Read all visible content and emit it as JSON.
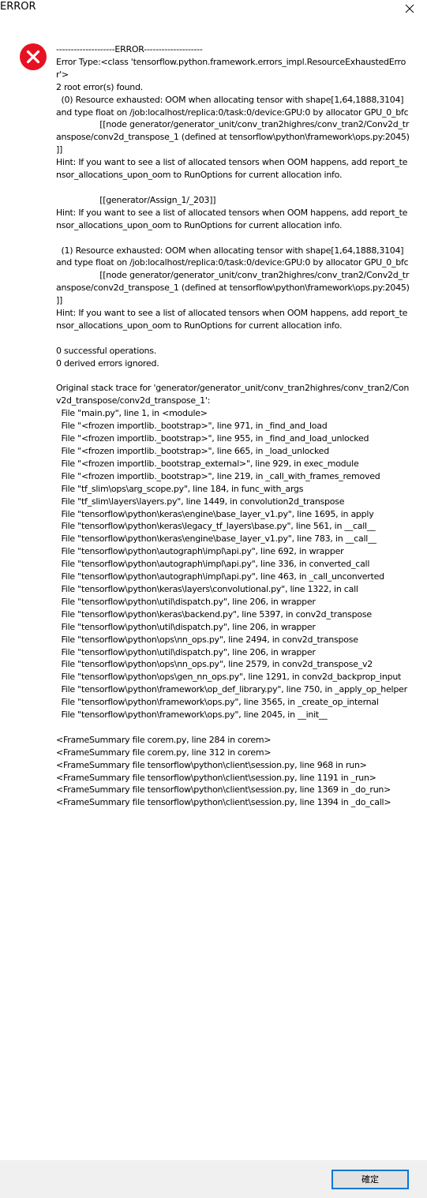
{
  "window": {
    "title": "ERROR",
    "close_icon": "close-icon"
  },
  "dialog": {
    "icon": "error-icon",
    "icon_color": "#e81123",
    "message": "--------------------ERROR--------------------\nError Type:<class 'tensorflow.python.framework.errors_impl.ResourceExhaustedError'>\n2 root error(s) found.\n  (0) Resource exhausted: OOM when allocating tensor with shape[1,64,1888,3104] and type float on /job:localhost/replica:0/task:0/device:GPU:0 by allocator GPU_0_bfc\n                 [[node generator/generator_unit/conv_tran2highres/conv_tran2/Conv2d_transpose/conv2d_transpose_1 (defined at tensorflow\\python\\framework\\ops.py:2045) ]]\nHint: If you want to see a list of allocated tensors when OOM happens, add report_tensor_allocations_upon_oom to RunOptions for current allocation info.\n\n                 [[generator/Assign_1/_203]]\nHint: If you want to see a list of allocated tensors when OOM happens, add report_tensor_allocations_upon_oom to RunOptions for current allocation info.\n\n  (1) Resource exhausted: OOM when allocating tensor with shape[1,64,1888,3104] and type float on /job:localhost/replica:0/task:0/device:GPU:0 by allocator GPU_0_bfc\n                 [[node generator/generator_unit/conv_tran2highres/conv_tran2/Conv2d_transpose/conv2d_transpose_1 (defined at tensorflow\\python\\framework\\ops.py:2045) ]]\nHint: If you want to see a list of allocated tensors when OOM happens, add report_tensor_allocations_upon_oom to RunOptions for current allocation info.\n\n0 successful operations.\n0 derived errors ignored.\n\nOriginal stack trace for 'generator/generator_unit/conv_tran2highres/conv_tran2/Conv2d_transpose/conv2d_transpose_1':\n  File \"main.py\", line 1, in <module>\n  File \"<frozen importlib._bootstrap>\", line 971, in _find_and_load\n  File \"<frozen importlib._bootstrap>\", line 955, in _find_and_load_unlocked\n  File \"<frozen importlib._bootstrap>\", line 665, in _load_unlocked\n  File \"<frozen importlib._bootstrap_external>\", line 929, in exec_module\n  File \"<frozen importlib._bootstrap>\", line 219, in _call_with_frames_removed\n  File \"tf_slim\\ops\\arg_scope.py\", line 184, in func_with_args\n  File \"tf_slim\\layers\\layers.py\", line 1449, in convolution2d_transpose\n  File \"tensorflow\\python\\keras\\engine\\base_layer_v1.py\", line 1695, in apply\n  File \"tensorflow\\python\\keras\\legacy_tf_layers\\base.py\", line 561, in __call__\n  File \"tensorflow\\python\\keras\\engine\\base_layer_v1.py\", line 783, in __call__\n  File \"tensorflow\\python\\autograph\\impl\\api.py\", line 692, in wrapper\n  File \"tensorflow\\python\\autograph\\impl\\api.py\", line 336, in converted_call\n  File \"tensorflow\\python\\autograph\\impl\\api.py\", line 463, in _call_unconverted\n  File \"tensorflow\\python\\keras\\layers\\convolutional.py\", line 1322, in call\n  File \"tensorflow\\python\\util\\dispatch.py\", line 206, in wrapper\n  File \"tensorflow\\python\\keras\\backend.py\", line 5397, in conv2d_transpose\n  File \"tensorflow\\python\\util\\dispatch.py\", line 206, in wrapper\n  File \"tensorflow\\python\\ops\\nn_ops.py\", line 2494, in conv2d_transpose\n  File \"tensorflow\\python\\util\\dispatch.py\", line 206, in wrapper\n  File \"tensorflow\\python\\ops\\nn_ops.py\", line 2579, in conv2d_transpose_v2\n  File \"tensorflow\\python\\ops\\gen_nn_ops.py\", line 1291, in conv2d_backprop_input\n  File \"tensorflow\\python\\framework\\op_def_library.py\", line 750, in _apply_op_helper\n  File \"tensorflow\\python\\framework\\ops.py\", line 3565, in _create_op_internal\n  File \"tensorflow\\python\\framework\\ops.py\", line 2045, in __init__\n\n<FrameSummary file corem.py, line 284 in corem>\n<FrameSummary file corem.py, line 312 in corem>\n<FrameSummary file tensorflow\\python\\client\\session.py, line 968 in run>\n<FrameSummary file tensorflow\\python\\client\\session.py, line 1191 in _run>\n<FrameSummary file tensorflow\\python\\client\\session.py, line 1369 in _do_run>\n<FrameSummary file tensorflow\\python\\client\\session.py, line 1394 in _do_call>"
  },
  "footer": {
    "ok_label": "確定",
    "accent_color": "#0078d7"
  }
}
